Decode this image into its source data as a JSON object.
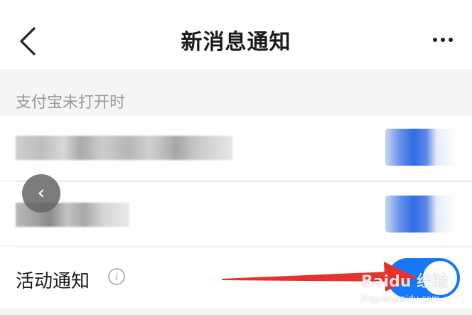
{
  "header": {
    "title": "新消息通知",
    "back_icon": "chevron-left-icon",
    "more_icon": "more-horizontal-icon"
  },
  "section": {
    "label": "支付宝未打开时"
  },
  "settings": [
    {
      "label_obscured": true,
      "enabled": true
    },
    {
      "label_obscured": true,
      "enabled": true
    },
    {
      "label": "活动通知",
      "info_icon": "info-icon",
      "enabled": true
    }
  ],
  "floating_back": {
    "icon": "chevron-left-icon",
    "glyph": "‹"
  },
  "info_glyph": "i",
  "watermark": {
    "text": "Baidu 经验",
    "sub": "jingyan.baidu.com"
  },
  "colors": {
    "toggle_on": "#1677ff",
    "arrow": "#e5322d",
    "background": "#f5f5f5"
  }
}
